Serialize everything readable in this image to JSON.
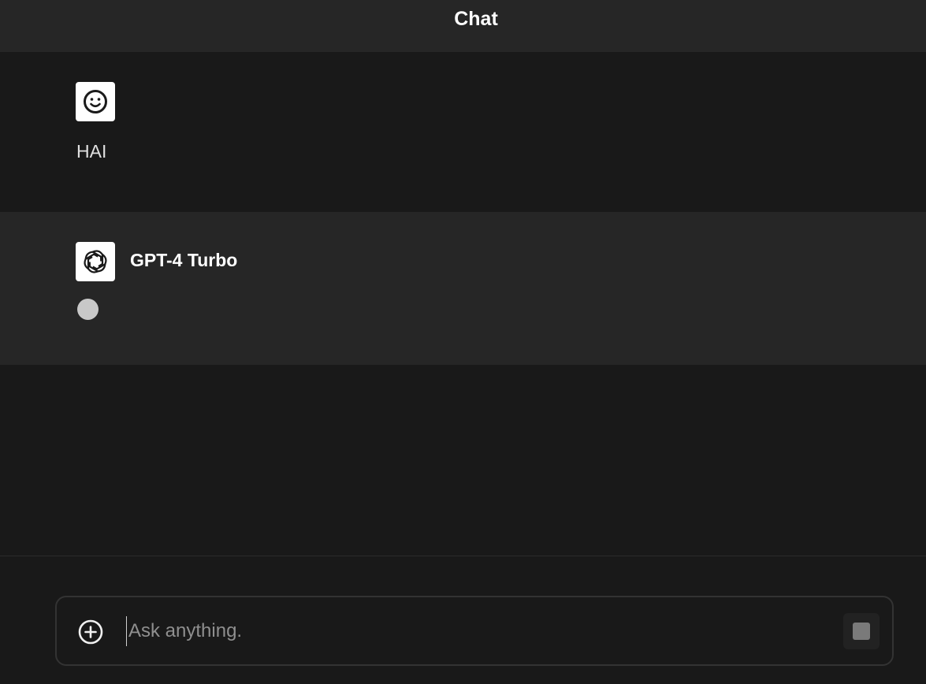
{
  "header": {
    "title": "Chat"
  },
  "conversation": {
    "user_message": {
      "avatar_icon": "smiley-icon",
      "text": "HAI"
    },
    "assistant_message": {
      "avatar_icon": "openai-logo-icon",
      "model_name": "GPT-4 Turbo",
      "status": "typing-indicator"
    }
  },
  "composer": {
    "placeholder": "Ask anything.",
    "value": "",
    "attach_icon": "plus-circle-icon",
    "stop_icon": "stop-icon"
  },
  "colors": {
    "background": "#191919",
    "panel": "#262626",
    "text": "#ececec",
    "placeholder": "#8f8f8f"
  }
}
